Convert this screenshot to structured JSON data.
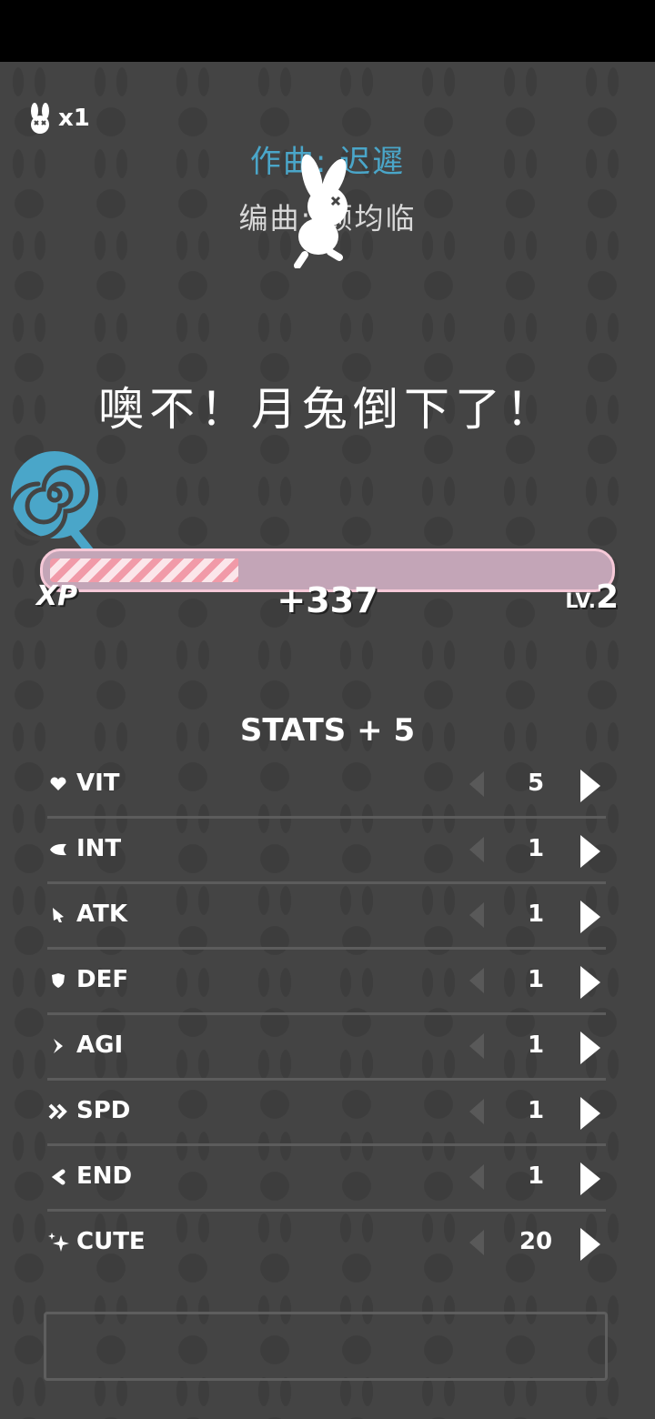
{
  "lives": {
    "count": "x1"
  },
  "credits": {
    "composer": "作曲: 迟遲",
    "arranger": "编曲: 顾均临"
  },
  "headline": "噢不！月兔倒下了！",
  "xp": {
    "label": "XP",
    "gain": "+337",
    "level_prefix": "LV.",
    "level": "2",
    "progress": 0.34
  },
  "stats": {
    "title": "STATS + 5",
    "rows": [
      {
        "icon": "heart-icon",
        "name": "VIT",
        "value": "5"
      },
      {
        "icon": "brain-icon",
        "name": "INT",
        "value": "1"
      },
      {
        "icon": "sword-icon",
        "name": "ATK",
        "value": "1"
      },
      {
        "icon": "shield-icon",
        "name": "DEF",
        "value": "1"
      },
      {
        "icon": "arrow-icon",
        "name": "AGI",
        "value": "1"
      },
      {
        "icon": "double-chevron-icon",
        "name": "SPD",
        "value": "1"
      },
      {
        "icon": "loop-arrow-icon",
        "name": "END",
        "value": "1"
      },
      {
        "icon": "sparkle-icon",
        "name": "CUTE",
        "value": "20"
      }
    ]
  },
  "colors": {
    "background": "#444444",
    "accent_blue": "#4aa6c9",
    "xp_border": "#f6c9d8",
    "xp_track": "#c3a5b7"
  }
}
